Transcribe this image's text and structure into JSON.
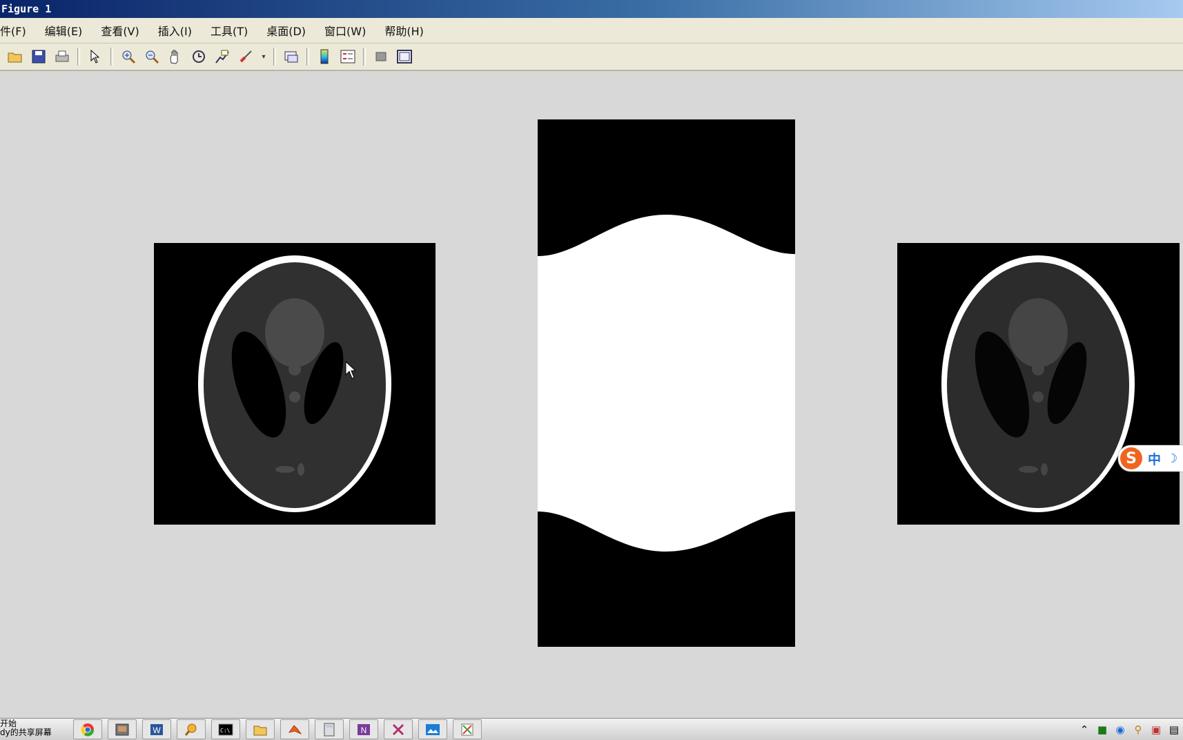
{
  "window": {
    "title": "Figure 1"
  },
  "menu": {
    "items": [
      "件(F)",
      "编辑(E)",
      "查看(V)",
      "插入(I)",
      "工具(T)",
      "桌面(D)",
      "窗口(W)",
      "帮助(H)"
    ]
  },
  "toolbar": {
    "icons": [
      "open-icon",
      "save-icon",
      "print-icon",
      "arrow-icon",
      "zoom-in-icon",
      "zoom-out-icon",
      "pan-icon",
      "rotate-icon",
      "data-cursor-icon",
      "brush-icon",
      "link-icon",
      "colorbar-icon",
      "legend-icon",
      "hide-tools-icon",
      "show-tools-icon"
    ]
  },
  "taskbar": {
    "start_label_line1": "开始",
    "start_label_line2": "dy的共享屏幕",
    "apps": [
      "chrome-icon",
      "presentation-icon",
      "word-icon",
      "search-tool-icon",
      "cmd-icon",
      "folder-icon",
      "matlab-icon",
      "calculator-icon",
      "onenote-icon",
      "xmind-icon",
      "photos-icon",
      "paint-icon"
    ]
  },
  "ime": {
    "logo": "S",
    "mode": "中",
    "moon": "☽"
  }
}
